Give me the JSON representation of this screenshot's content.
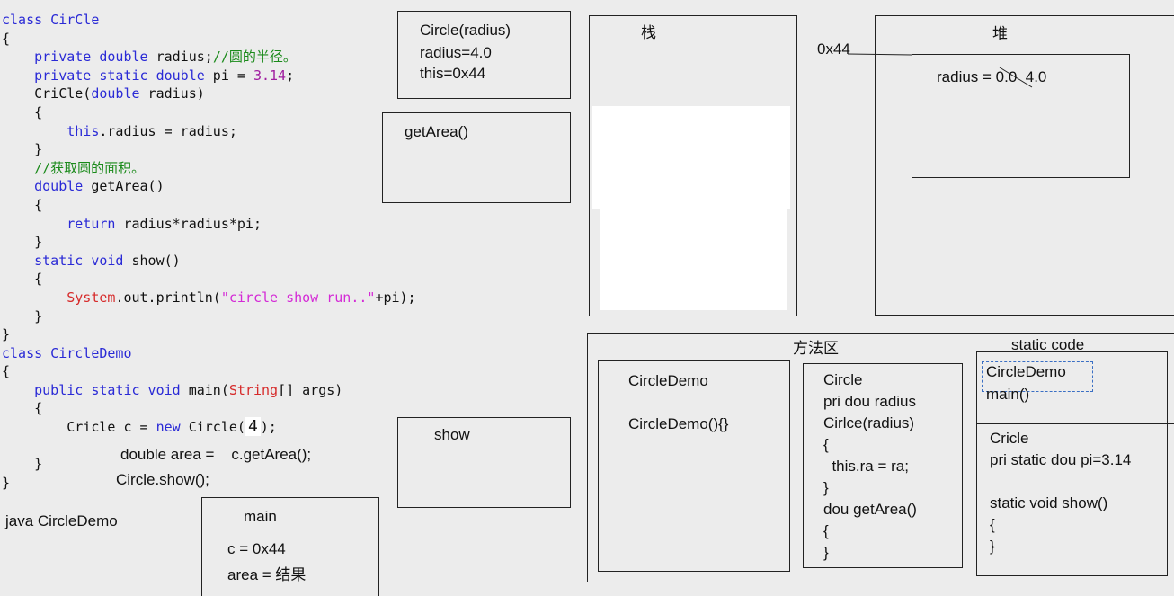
{
  "code_lines": [
    [
      {
        "t": "class CirCle",
        "c": "kw"
      }
    ],
    [
      {
        "t": "{",
        "c": ""
      }
    ],
    [
      {
        "t": "    ",
        "c": ""
      },
      {
        "t": "private double",
        "c": "kw"
      },
      {
        "t": " radius;",
        "c": ""
      },
      {
        "t": "//圆的半径。",
        "c": "cm"
      }
    ],
    [
      {
        "t": "    ",
        "c": ""
      },
      {
        "t": "private static double",
        "c": "kw"
      },
      {
        "t": " pi = ",
        "c": ""
      },
      {
        "t": "3.14",
        "c": "num"
      },
      {
        "t": ";",
        "c": ""
      }
    ],
    [
      {
        "t": "    CriCle(",
        "c": ""
      },
      {
        "t": "double",
        "c": "kw"
      },
      {
        "t": " radius)",
        "c": ""
      }
    ],
    [
      {
        "t": "    {",
        "c": ""
      }
    ],
    [
      {
        "t": "        ",
        "c": ""
      },
      {
        "t": "this",
        "c": "kw"
      },
      {
        "t": ".radius = radius;",
        "c": ""
      }
    ],
    [
      {
        "t": "    }",
        "c": ""
      }
    ],
    [
      {
        "t": "    ",
        "c": ""
      },
      {
        "t": "//获取圆的面积。",
        "c": "cm"
      }
    ],
    [
      {
        "t": "    ",
        "c": ""
      },
      {
        "t": "double",
        "c": "kw"
      },
      {
        "t": " getArea()",
        "c": ""
      }
    ],
    [
      {
        "t": "    {",
        "c": ""
      }
    ],
    [
      {
        "t": "        ",
        "c": ""
      },
      {
        "t": "return",
        "c": "kw"
      },
      {
        "t": " radius*radius*pi;",
        "c": ""
      }
    ],
    [
      {
        "t": "    }",
        "c": ""
      }
    ],
    [
      {
        "t": "    ",
        "c": ""
      },
      {
        "t": "static void",
        "c": "kw"
      },
      {
        "t": " show()",
        "c": ""
      }
    ],
    [
      {
        "t": "    {",
        "c": ""
      }
    ],
    [
      {
        "t": "        ",
        "c": ""
      },
      {
        "t": "System",
        "c": "cls"
      },
      {
        "t": ".out.println(",
        "c": ""
      },
      {
        "t": "\"circle show run..\"",
        "c": "str"
      },
      {
        "t": "+pi);",
        "c": ""
      }
    ],
    [
      {
        "t": "    }",
        "c": ""
      }
    ],
    [
      {
        "t": "}",
        "c": ""
      }
    ],
    [
      {
        "t": "class CircleDemo",
        "c": "kw"
      }
    ],
    [
      {
        "t": "{",
        "c": ""
      }
    ],
    [
      {
        "t": "    ",
        "c": ""
      },
      {
        "t": "public static void",
        "c": "kw"
      },
      {
        "t": " main(",
        "c": ""
      },
      {
        "t": "String",
        "c": "cls"
      },
      {
        "t": "[] args)",
        "c": ""
      }
    ],
    [
      {
        "t": "    {",
        "c": ""
      }
    ],
    [
      {
        "t": "        Cricle c = ",
        "c": ""
      },
      {
        "t": "new",
        "c": "kw"
      },
      {
        "t": " Circle(",
        "c": ""
      },
      {
        "t": "4",
        "c": "box4"
      },
      {
        "t": ");",
        "c": ""
      }
    ],
    [
      {
        "t": "",
        "c": ""
      }
    ],
    [
      {
        "t": "    }",
        "c": ""
      }
    ],
    [
      {
        "t": "}",
        "c": ""
      }
    ]
  ],
  "handwritten": {
    "area_line": "double area =    c.getArea();",
    "show_line": "Circle.show();",
    "java_cmd": "java CircleDemo"
  },
  "frames": {
    "constructor": {
      "title": "Circle(radius)",
      "l1": "radius=4.0",
      "l2": "this=0x44"
    },
    "getarea": {
      "title": "getArea()"
    },
    "show": {
      "title": "show"
    },
    "main": {
      "title": "main",
      "l1": "c = 0x44",
      "l2": "area = 结果"
    }
  },
  "stack": {
    "title": "栈"
  },
  "heap": {
    "title": "堆",
    "addr": "0x44",
    "field": "radius = 0.0  4.0"
  },
  "method_area": {
    "title": "方法区",
    "static_title": "static code",
    "circledemo": {
      "l1": "CircleDemo",
      "l2": "CircleDemo(){}"
    },
    "circle": [
      "Circle",
      "pri dou radius",
      "Cirlce(radius)",
      "{",
      "  this.ra = ra;",
      "}",
      "dou getArea()",
      "{",
      "}"
    ],
    "static_demo": [
      "CircleDemo",
      "main()"
    ],
    "static_circle": [
      "Cricle",
      "pri static dou pi=3.14",
      "",
      "static void show()",
      "{",
      "}"
    ]
  },
  "colors": {
    "keyword": "#2a2ad6",
    "string": "#d42ad6",
    "class": "#d62a2a",
    "comment": "#1a8a1a",
    "background": "#ececec"
  }
}
